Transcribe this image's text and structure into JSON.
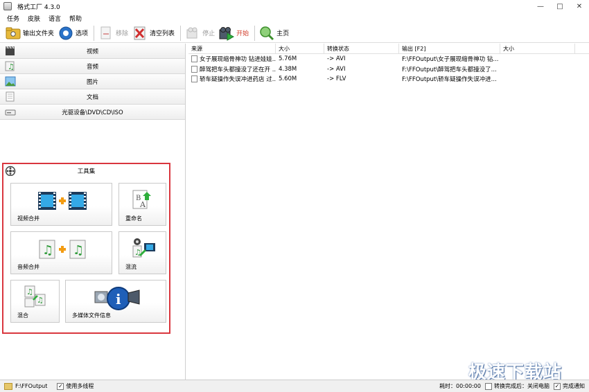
{
  "window": {
    "title": "格式工厂 4.3.0"
  },
  "menu": [
    "任务",
    "皮肤",
    "语言",
    "帮助"
  ],
  "toolbar": {
    "output_folder": "输出文件夹",
    "options": "选项",
    "remove": "移除",
    "clear_list": "清空列表",
    "stop": "停止",
    "start": "开始",
    "home": "主页"
  },
  "categories": [
    "视频",
    "音频",
    "图片",
    "文档",
    "光驱设备\\DVD\\CD\\ISO",
    "工具集"
  ],
  "tools": {
    "video_merge": "视频合并",
    "rename": "重命名",
    "audio_merge": "音频合并",
    "mux": "混流",
    "mix": "混合",
    "media_info": "多媒体文件信息"
  },
  "file_list": {
    "columns": [
      "来源",
      "大小",
      "转换状态",
      "输出 [F2]",
      "大小"
    ],
    "rows": [
      {
        "source": "女子展现缩骨神功 钻进娃娃...",
        "size": "5.76M",
        "status": "-> AVI",
        "output": "F:\\FFOutput\\女子展现缩骨神功 钻...",
        "out_size": ""
      },
      {
        "source": "醉驾把车头都撞没了还在开 ...",
        "size": "4.38M",
        "status": "-> AVI",
        "output": "F:\\FFOutput\\醉驾把车头都撞没了...",
        "out_size": ""
      },
      {
        "source": "轿车疑操作失误冲进药店 过...",
        "size": "5.60M",
        "status": "-> FLV",
        "output": "F:\\FFOutput\\轿车疑操作失误冲进...",
        "out_size": ""
      }
    ]
  },
  "statusbar": {
    "output_path": "F:\\FFOutput",
    "multithread": "使用多线程",
    "elapsed": "耗时：00:00:00",
    "after_convert": "转换完成后：关闭电脑",
    "notify": "完成通知"
  },
  "watermark": "极速下载站",
  "colors": {
    "highlight_border": "#d9363e",
    "accent_blue": "#1f6fd1",
    "start_red": "#d23c2a"
  }
}
